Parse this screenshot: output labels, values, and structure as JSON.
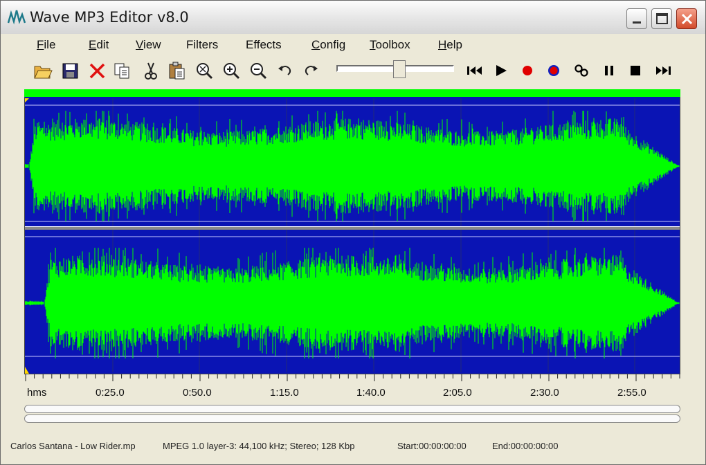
{
  "window": {
    "title": "Wave MP3 Editor v8.0"
  },
  "menu": [
    {
      "key": "file",
      "label": "File",
      "ul": "F",
      "rest": "ile"
    },
    {
      "key": "edit",
      "label": "Edit",
      "ul": "E",
      "rest": "dit"
    },
    {
      "key": "view",
      "label": "View",
      "ul": "V",
      "rest": "iew"
    },
    {
      "key": "filters",
      "label": "Filters",
      "ul": "",
      "rest": "Filters"
    },
    {
      "key": "effects",
      "label": "Effects",
      "ul": "",
      "rest": "Effects"
    },
    {
      "key": "config",
      "label": "Config",
      "ul": "C",
      "rest": "onfig"
    },
    {
      "key": "toolbox",
      "label": "Toolbox",
      "ul": "T",
      "rest": "oolbox"
    },
    {
      "key": "help",
      "label": "Help",
      "ul": "H",
      "rest": "elp"
    }
  ],
  "toolbar": {
    "icons": [
      "open-folder-icon",
      "save-icon",
      "delete-icon",
      "copy-icon",
      "cut-icon",
      "paste-icon",
      "zoom-fit-icon",
      "zoom-in-icon",
      "zoom-out-icon",
      "undo-icon",
      "redo-icon"
    ],
    "transport": [
      "skip-back-icon",
      "play-icon",
      "record-icon",
      "record-monitor-icon",
      "loop-icon",
      "pause-icon",
      "stop-icon",
      "skip-forward-icon"
    ],
    "volume_level": 0.5
  },
  "ruler": {
    "unit_label": "hms",
    "ticks": [
      "0:25.0",
      "0:50.0",
      "1:15.0",
      "1:40.0",
      "2:05.0",
      "2:30.0",
      "2:55.0"
    ]
  },
  "status": {
    "file": "Carlos Santana - Low Rider.mp",
    "format": "MPEG 1.0 layer-3: 44,100 kHz; Stereo; 128 Kbp",
    "start": "Start:00:00:00:00",
    "end": "End:00:00:00:00"
  },
  "colors": {
    "wave_bg": "#0a14b4",
    "wave_fg": "#00ff00",
    "record": "#e00000"
  }
}
